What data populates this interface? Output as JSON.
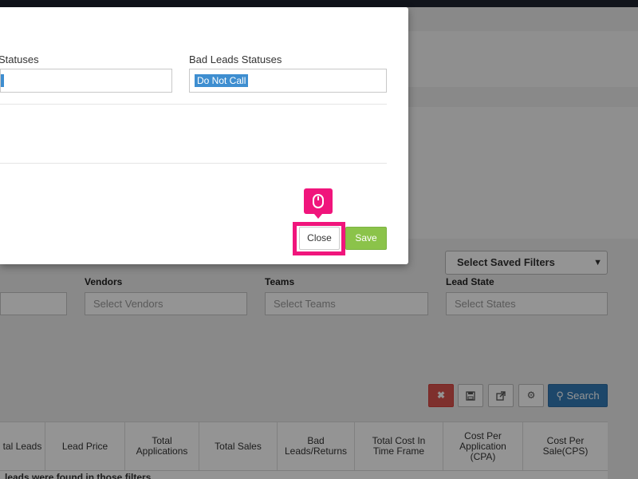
{
  "modal": {
    "left_field_label": "Statuses",
    "bad_leads_label": "Bad Leads Statuses",
    "bad_leads_tag": "Do Not Call",
    "close_label": "Close",
    "save_label": "Save"
  },
  "filters": {
    "saved_filters": "Select Saved Filters",
    "vendors_label": "Vendors",
    "vendors_placeholder": "Select Vendors",
    "teams_label": "Teams",
    "teams_placeholder": "Select Teams",
    "lead_state_label": "Lead State",
    "lead_state_placeholder": "Select States"
  },
  "toolbar": {
    "clear_icon": "times-icon",
    "save_icon": "floppy-icon",
    "export_icon": "external-link-icon",
    "settings_icon": "gear-icon",
    "search_label": "Search"
  },
  "table": {
    "headers": [
      "tal Leads",
      "Lead Price",
      "Total Applications",
      "Total Sales",
      "Bad Leads/Returns",
      "Total Cost In Time Frame",
      "Cost Per Application (CPA)",
      "Cost Per Sale(CPS)"
    ],
    "empty_message": "leads were found in those filters"
  },
  "colors": {
    "highlight": "#f0157c",
    "primary": "#337ab7",
    "success": "#8bc34a",
    "danger": "#d9534f",
    "tag": "#3e8ed0"
  }
}
